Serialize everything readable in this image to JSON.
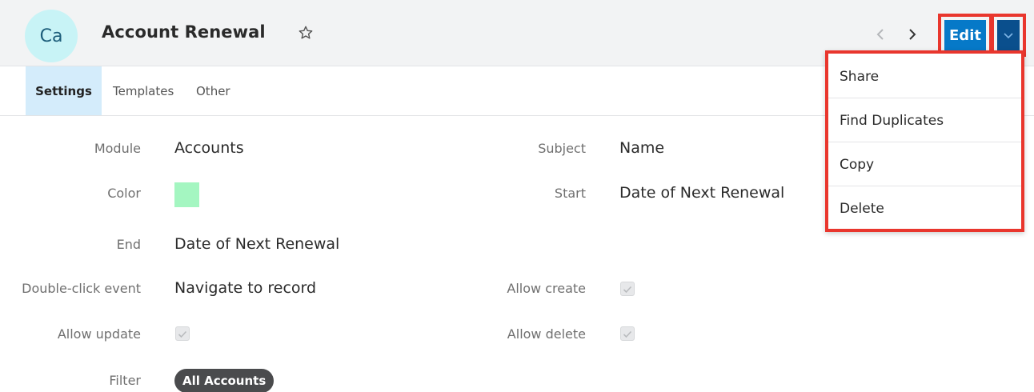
{
  "header": {
    "avatar_initials": "Ca",
    "title": "Account Renewal",
    "favorite_icon": "star-outline-icon",
    "prev_icon": "chevron-left-icon",
    "next_icon": "chevron-right-icon",
    "edit_label": "Edit",
    "actions_icon": "chevron-down-icon"
  },
  "tabs": [
    {
      "label": "Settings",
      "active": true
    },
    {
      "label": "Templates",
      "active": false
    },
    {
      "label": "Other",
      "active": false
    }
  ],
  "fields": {
    "module": {
      "label": "Module",
      "value": "Accounts"
    },
    "subject": {
      "label": "Subject",
      "value": "Name"
    },
    "color": {
      "label": "Color",
      "value": "#a4f6c1"
    },
    "start": {
      "label": "Start",
      "value": "Date of Next Renewal"
    },
    "end": {
      "label": "End",
      "value": "Date of Next Renewal"
    },
    "double_click_event": {
      "label": "Double-click event",
      "value": "Navigate to record"
    },
    "allow_create": {
      "label": "Allow create",
      "checked": true
    },
    "allow_update": {
      "label": "Allow update",
      "checked": true
    },
    "allow_delete": {
      "label": "Allow delete",
      "checked": true
    },
    "filter": {
      "label": "Filter",
      "value": "All Accounts"
    }
  },
  "actions_menu": {
    "items": [
      {
        "label": "Share"
      },
      {
        "label": "Find Duplicates"
      },
      {
        "label": "Copy"
      },
      {
        "label": "Delete"
      }
    ]
  },
  "colors": {
    "primary_button": "#0679c8",
    "caret_button": "#0a4f8d",
    "highlight_outline": "#e9362d",
    "active_tab_bg": "#d4ecfb",
    "avatar_bg": "#c8f3f6"
  }
}
